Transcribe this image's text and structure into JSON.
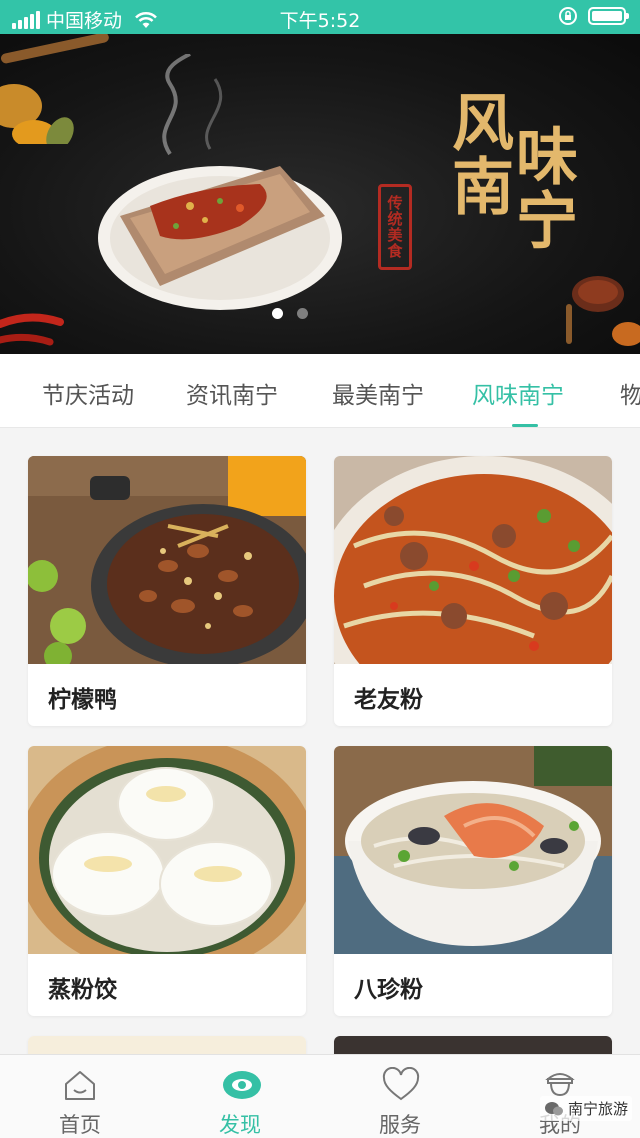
{
  "status_bar": {
    "carrier": "中国移动",
    "time": "下午5:52",
    "icons": [
      "signal-icon",
      "wifi-icon",
      "orientation-lock-icon",
      "battery-icon"
    ],
    "color": "#33c4a8"
  },
  "banner": {
    "title_col1": "风南",
    "title_col2": "味宁",
    "seal_text": "传统美食",
    "page_count": 2,
    "active_page": 1
  },
  "tabs": {
    "items": [
      "节庆活动",
      "资讯南宁",
      "最美南宁",
      "风味南宁",
      "物"
    ],
    "active_index": 3,
    "accent": "#35c0a5"
  },
  "cards": [
    {
      "name": "柠檬鸭",
      "image": "lemon-duck-photo"
    },
    {
      "name": "老友粉",
      "image": "laoyou-noodles-photo"
    },
    {
      "name": "蒸粉饺",
      "image": "steamed-dumplings-photo"
    },
    {
      "name": "八珍粉",
      "image": "bazhen-noodles-photo"
    }
  ],
  "bottom_nav": {
    "items": [
      {
        "label": "首页",
        "icon": "home-icon"
      },
      {
        "label": "发现",
        "icon": "eye-icon"
      },
      {
        "label": "服务",
        "icon": "heart-icon"
      },
      {
        "label": "我的",
        "icon": "user-icon"
      }
    ],
    "active_index": 1
  },
  "watermark": {
    "text": "南宁旅游",
    "icon": "wechat-icon"
  }
}
